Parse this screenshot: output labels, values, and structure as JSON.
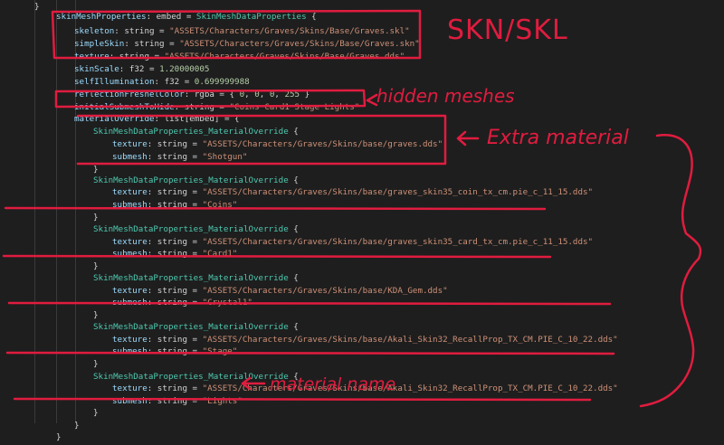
{
  "code_lines": [
    {
      "id": "brace-open",
      "tokens": [
        {
          "t": "}",
          "c": "plain"
        }
      ]
    },
    {
      "id": "skinmesh-props",
      "tokens": [
        {
          "t": "skinMeshProperties",
          "c": "key"
        },
        {
          "t": ": embed = ",
          "c": "plain"
        },
        {
          "t": "SkinMeshDataProperties",
          "c": "type"
        },
        {
          "t": " {",
          "c": "plain"
        }
      ]
    },
    {
      "id": "skeleton",
      "tokens": [
        {
          "t": "skeleton",
          "c": "key"
        },
        {
          "t": ": string = ",
          "c": "plain"
        },
        {
          "t": "\"ASSETS/Characters/Graves/Skins/Base/Graves.skl\"",
          "c": "str"
        }
      ]
    },
    {
      "id": "simple-skin",
      "tokens": [
        {
          "t": "simpleSkin",
          "c": "key"
        },
        {
          "t": ": string = ",
          "c": "plain"
        },
        {
          "t": "\"ASSETS/Characters/Graves/Skins/Base/Graves.skn\"",
          "c": "str"
        }
      ]
    },
    {
      "id": "texture-main",
      "tokens": [
        {
          "t": "texture",
          "c": "key"
        },
        {
          "t": ": string = ",
          "c": "plain"
        },
        {
          "t": "\"ASSETS/Characters/Graves/Skins/Base/Graves.dds\"",
          "c": "str"
        }
      ]
    },
    {
      "id": "skin-scale",
      "tokens": [
        {
          "t": "skinScale",
          "c": "key"
        },
        {
          "t": ": f32 = ",
          "c": "plain"
        },
        {
          "t": "1.20000005",
          "c": "num"
        }
      ]
    },
    {
      "id": "self-illumination",
      "tokens": [
        {
          "t": "selfIllumination",
          "c": "key"
        },
        {
          "t": ": f32 = ",
          "c": "plain"
        },
        {
          "t": "0.699999988",
          "c": "num"
        }
      ]
    },
    {
      "id": "reflection-fresnel",
      "tokens": [
        {
          "t": "reflectionFresnelColor",
          "c": "key"
        },
        {
          "t": ": rgba = { ",
          "c": "plain"
        },
        {
          "t": "0",
          "c": "num"
        },
        {
          "t": ", ",
          "c": "plain"
        },
        {
          "t": "0",
          "c": "num"
        },
        {
          "t": ", ",
          "c": "plain"
        },
        {
          "t": "0",
          "c": "num"
        },
        {
          "t": ", ",
          "c": "plain"
        },
        {
          "t": "255",
          "c": "num"
        },
        {
          "t": " }",
          "c": "plain"
        }
      ]
    },
    {
      "id": "initial-submesh-hide",
      "tokens": [
        {
          "t": "initialSubmeshToHide",
          "c": "key"
        },
        {
          "t": ": string = ",
          "c": "plain"
        },
        {
          "t": "\"Coins Card1 Stage Lights\"",
          "c": "str"
        }
      ]
    },
    {
      "id": "material-override",
      "tokens": [
        {
          "t": "materialOverride",
          "c": "key"
        },
        {
          "t": ": list[embed] = {",
          "c": "plain"
        }
      ]
    },
    {
      "id": "mo1-open",
      "tokens": [
        {
          "t": "SkinMeshDataProperties_MaterialOverride",
          "c": "type"
        },
        {
          "t": " {",
          "c": "plain"
        }
      ]
    },
    {
      "id": "mo1-texture",
      "tokens": [
        {
          "t": "texture",
          "c": "key"
        },
        {
          "t": ": string = ",
          "c": "plain"
        },
        {
          "t": "\"ASSETS/Characters/Graves/Skins/base/graves.dds\"",
          "c": "str"
        }
      ]
    },
    {
      "id": "mo1-submesh",
      "tokens": [
        {
          "t": "submesh",
          "c": "key"
        },
        {
          "t": ": string = ",
          "c": "plain"
        },
        {
          "t": "\"Shotgun\"",
          "c": "str"
        }
      ]
    },
    {
      "id": "mo1-close",
      "tokens": [
        {
          "t": "}",
          "c": "plain"
        }
      ]
    },
    {
      "id": "mo2-open",
      "tokens": [
        {
          "t": "SkinMeshDataProperties_MaterialOverride",
          "c": "type"
        },
        {
          "t": " {",
          "c": "plain"
        }
      ]
    },
    {
      "id": "mo2-texture",
      "tokens": [
        {
          "t": "texture",
          "c": "key"
        },
        {
          "t": ": string = ",
          "c": "plain"
        },
        {
          "t": "\"ASSETS/Characters/Graves/Skins/base/graves_skin35_coin_tx_cm.pie_c_11_15.dds\"",
          "c": "str"
        }
      ]
    },
    {
      "id": "mo2-submesh",
      "tokens": [
        {
          "t": "submesh",
          "c": "key"
        },
        {
          "t": ": string = ",
          "c": "plain"
        },
        {
          "t": "\"Coins\"",
          "c": "str"
        }
      ]
    },
    {
      "id": "mo2-close",
      "tokens": [
        {
          "t": "}",
          "c": "plain"
        }
      ]
    },
    {
      "id": "mo3-open",
      "tokens": [
        {
          "t": "SkinMeshDataProperties_MaterialOverride",
          "c": "type"
        },
        {
          "t": " {",
          "c": "plain"
        }
      ]
    },
    {
      "id": "mo3-texture",
      "tokens": [
        {
          "t": "texture",
          "c": "key"
        },
        {
          "t": ": string = ",
          "c": "plain"
        },
        {
          "t": "\"ASSETS/Characters/Graves/Skins/base/graves_skin35_card_tx_cm.pie_c_11_15.dds\"",
          "c": "str"
        }
      ]
    },
    {
      "id": "mo3-submesh",
      "tokens": [
        {
          "t": "submesh",
          "c": "key"
        },
        {
          "t": ": string = ",
          "c": "plain"
        },
        {
          "t": "\"Card1\"",
          "c": "str"
        }
      ]
    },
    {
      "id": "mo3-close",
      "tokens": [
        {
          "t": "}",
          "c": "plain"
        }
      ]
    },
    {
      "id": "mo4-open",
      "tokens": [
        {
          "t": "SkinMeshDataProperties_MaterialOverride",
          "c": "type"
        },
        {
          "t": " {",
          "c": "plain"
        }
      ]
    },
    {
      "id": "mo4-texture",
      "tokens": [
        {
          "t": "texture",
          "c": "key"
        },
        {
          "t": ": string = ",
          "c": "plain"
        },
        {
          "t": "\"ASSETS/Characters/Graves/Skins/base/KDA_Gem.dds\"",
          "c": "str"
        }
      ]
    },
    {
      "id": "mo4-submesh",
      "tokens": [
        {
          "t": "submesh",
          "c": "key"
        },
        {
          "t": ": string = ",
          "c": "plain"
        },
        {
          "t": "\"Crystal1\"",
          "c": "str"
        }
      ]
    },
    {
      "id": "mo4-close",
      "tokens": [
        {
          "t": "}",
          "c": "plain"
        }
      ]
    },
    {
      "id": "mo5-open",
      "tokens": [
        {
          "t": "SkinMeshDataProperties_MaterialOverride",
          "c": "type"
        },
        {
          "t": " {",
          "c": "plain"
        }
      ]
    },
    {
      "id": "mo5-texture",
      "tokens": [
        {
          "t": "texture",
          "c": "key"
        },
        {
          "t": ": string = ",
          "c": "plain"
        },
        {
          "t": "\"ASSETS/Characters/Graves/Skins/base/Akali_Skin32_RecallProp_TX_CM.PIE_C_10_22.dds\"",
          "c": "str"
        }
      ]
    },
    {
      "id": "mo5-submesh",
      "tokens": [
        {
          "t": "submesh",
          "c": "key"
        },
        {
          "t": ": string = ",
          "c": "plain"
        },
        {
          "t": "\"Stage\"",
          "c": "str"
        }
      ]
    },
    {
      "id": "mo5-close",
      "tokens": [
        {
          "t": "}",
          "c": "plain"
        }
      ]
    },
    {
      "id": "mo6-open",
      "tokens": [
        {
          "t": "SkinMeshDataProperties_MaterialOverride",
          "c": "type"
        },
        {
          "t": " {",
          "c": "plain"
        }
      ]
    },
    {
      "id": "mo6-texture",
      "tokens": [
        {
          "t": "texture",
          "c": "key"
        },
        {
          "t": ": string = ",
          "c": "plain"
        },
        {
          "t": "\"ASSETS/Characters/Graves/Skins/base/Akali_Skin32_RecallProp_TX_CM.PIE_C_10_22.dds\"",
          "c": "str"
        }
      ]
    },
    {
      "id": "mo6-submesh",
      "tokens": [
        {
          "t": "submesh",
          "c": "key"
        },
        {
          "t": ": string = ",
          "c": "plain"
        },
        {
          "t": "\"Lights\"",
          "c": "str"
        }
      ]
    },
    {
      "id": "mo6-close",
      "tokens": [
        {
          "t": "}",
          "c": "plain"
        }
      ]
    },
    {
      "id": "material-override-close",
      "tokens": [
        {
          "t": "}",
          "c": "plain"
        }
      ]
    },
    {
      "id": "skinmesh-close",
      "tokens": [
        {
          "t": "}",
          "c": "plain"
        }
      ]
    }
  ],
  "annotations": {
    "skn_skl": "SKN/SKL",
    "hidden_meshes": "hidden meshes",
    "extra_material": "Extra material",
    "material_name": "material name"
  },
  "colors": {
    "editor_bg": "#1e1e1e",
    "key": "#9cdcfe",
    "type": "#4ec9b0",
    "string": "#ce9178",
    "number": "#b5cea8",
    "plain": "#d4d4d4",
    "annotation_red": "#e01c3f"
  }
}
